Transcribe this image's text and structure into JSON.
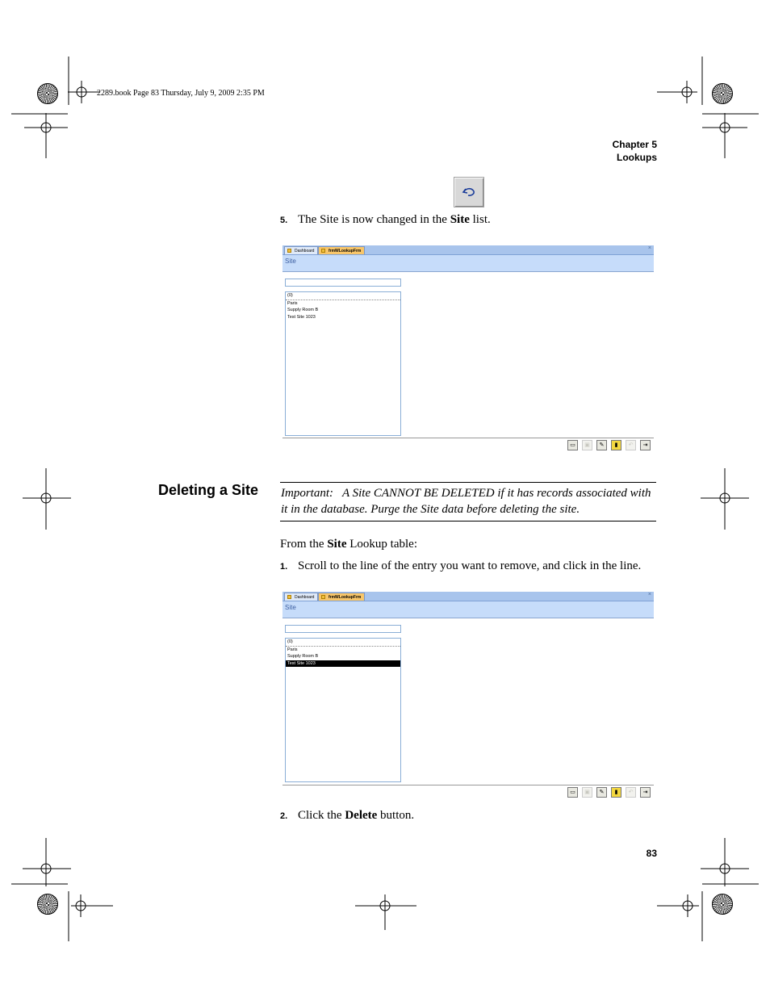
{
  "print_header": "2289.book  Page 83  Thursday, July 9, 2009  2:35 PM",
  "chapter": {
    "label": "Chapter 5",
    "title": "Lookups"
  },
  "undo_icon": "undo-arrow-icon",
  "steps_top": [
    {
      "num": "5.",
      "pre": "The Site is now changed in the ",
      "bold": "Site",
      "post": " list."
    }
  ],
  "app1": {
    "tabs": [
      {
        "label": "Dashboard"
      },
      {
        "label": "frmWLookupFrm"
      }
    ],
    "close_glyph": "×",
    "form_title": "Site",
    "list_items": [
      "(0)",
      "Paris",
      "Supply Room B",
      "Test Site 1023"
    ],
    "selected_index": -1
  },
  "section": {
    "heading": "Deleting a Site",
    "note_label": "Important:",
    "note_text": "A Site CANNOT BE DELETED if it has records associated with it in the database. Purge the Site data before deleting the site."
  },
  "intro": {
    "pre": "From the ",
    "bold": "Site",
    "post": " Lookup table:"
  },
  "step1": {
    "num": "1.",
    "text": "Scroll to the line of the entry you want to remove, and click in the line."
  },
  "app2": {
    "tabs": [
      {
        "label": "Dashboard"
      },
      {
        "label": "frmWLookupFrm"
      }
    ],
    "close_glyph": "×",
    "form_title": "Site",
    "list_items": [
      "(0)",
      "Paris",
      "Supply Room B",
      "Test Site 1023"
    ],
    "selected_index": 3
  },
  "step2": {
    "num": "2.",
    "pre": "Click the ",
    "bold": "Delete",
    "post": " button."
  },
  "toolbar_icons": [
    "new-record-icon",
    "save-icon",
    "edit-icon",
    "delete-icon",
    "undo-icon",
    "exit-icon"
  ],
  "page_number": "83"
}
